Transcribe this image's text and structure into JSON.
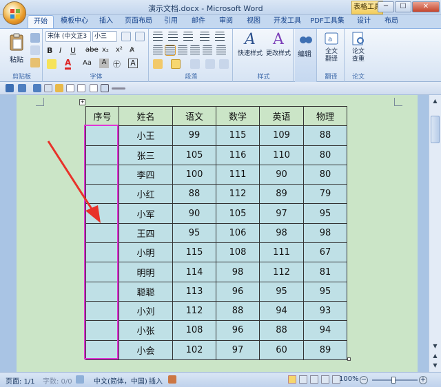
{
  "window": {
    "title": "演示文档.docx - Microsoft Word",
    "context_tab": "表格工具",
    "minimize": "─",
    "maximize": "☐",
    "close": "✕"
  },
  "tabs": [
    "开始",
    "模板中心",
    "插入",
    "页面布局",
    "引用",
    "邮件",
    "审阅",
    "视图",
    "开发工具",
    "PDF工具集",
    "设计",
    "布局"
  ],
  "ribbon": {
    "clipboard": {
      "label": "剪贴板",
      "paste": "粘贴"
    },
    "font": {
      "label": "字体",
      "font_name": "宋体 (中文正3",
      "font_size": "小三"
    },
    "paragraph": {
      "label": "段落"
    },
    "styles": {
      "label": "样式",
      "quick_styles": "快速样式",
      "change_styles": "更改样式"
    },
    "editing": {
      "label": "编辑"
    },
    "translate": {
      "label": "翻译",
      "full_translate": "全文\n翻译"
    },
    "paper": {
      "label": "论文",
      "check": "论文\n查重"
    }
  },
  "table": {
    "headers": [
      "序号",
      "姓名",
      "语文",
      "数学",
      "英语",
      "物理"
    ],
    "rows": [
      [
        "",
        "小王",
        "99",
        "115",
        "109",
        "88"
      ],
      [
        "",
        "张三",
        "105",
        "116",
        "110",
        "80"
      ],
      [
        "",
        "李四",
        "100",
        "111",
        "90",
        "80"
      ],
      [
        "",
        "小红",
        "88",
        "112",
        "89",
        "79"
      ],
      [
        "",
        "小军",
        "90",
        "105",
        "97",
        "95"
      ],
      [
        "",
        "王四",
        "95",
        "106",
        "98",
        "98"
      ],
      [
        "",
        "小明",
        "115",
        "108",
        "111",
        "67"
      ],
      [
        "",
        "明明",
        "114",
        "98",
        "112",
        "81"
      ],
      [
        "",
        "聪聪",
        "113",
        "96",
        "95",
        "95"
      ],
      [
        "",
        "小刘",
        "112",
        "88",
        "94",
        "93"
      ],
      [
        "",
        "小张",
        "108",
        "96",
        "88",
        "94"
      ],
      [
        "",
        "小会",
        "102",
        "97",
        "60",
        "89"
      ]
    ]
  },
  "status": {
    "page": "页面: 1/1",
    "words": "字数: 0/0",
    "language": "中文(简体，中国)",
    "mode": "插入",
    "zoom": "100%"
  },
  "colors": {
    "highlight": "#e034d6",
    "arrow": "#e8322a",
    "page_bg": "#cbe5c7",
    "cell_bg": "#bfe0e6"
  }
}
